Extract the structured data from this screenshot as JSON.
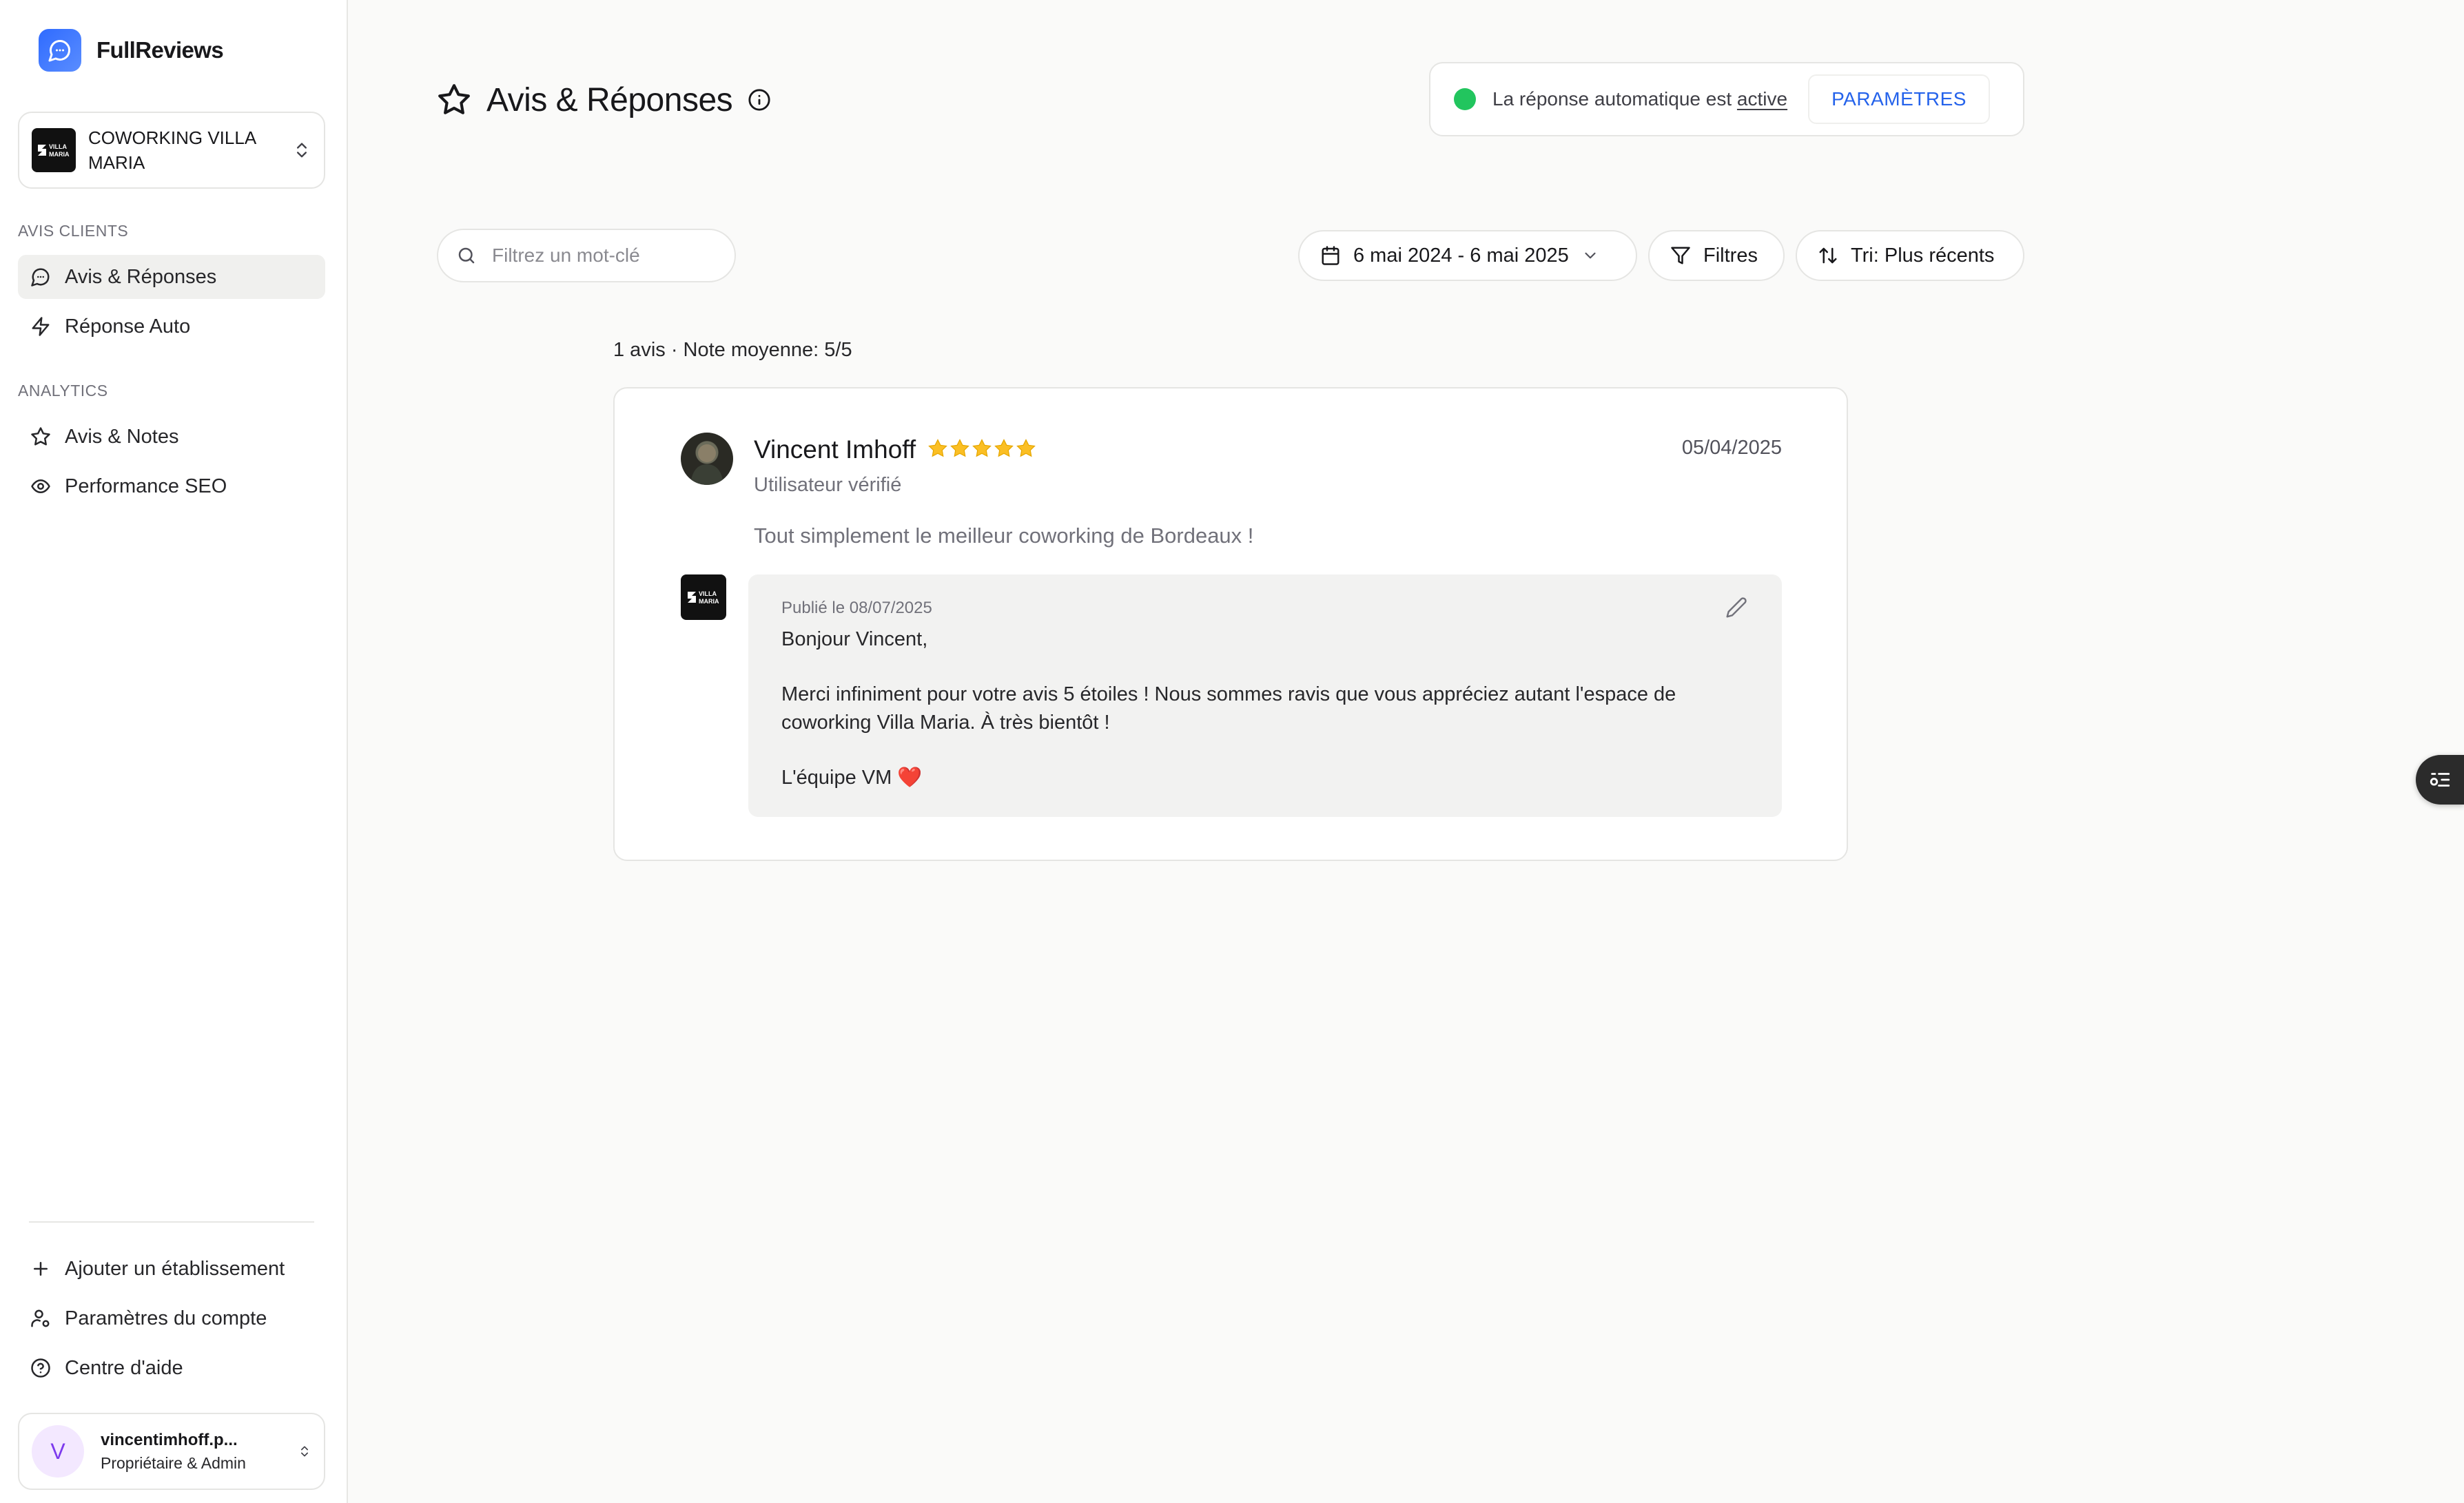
{
  "brand": {
    "name": "FullReviews",
    "accent": "#2f6bff"
  },
  "business": {
    "name": "COWORKING VILLA MARIA",
    "logo_text_1": "VILLA",
    "logo_text_2": "MARIA"
  },
  "sidebar": {
    "sections": [
      {
        "label": "AVIS CLIENTS",
        "items": [
          {
            "label": "Avis & Réponses",
            "icon": "chat-bubble-icon",
            "active": true
          },
          {
            "label": "Réponse Auto",
            "icon": "lightning-icon",
            "active": false
          }
        ]
      },
      {
        "label": "ANALYTICS",
        "items": [
          {
            "label": "Avis & Notes",
            "icon": "star-icon",
            "active": false
          },
          {
            "label": "Performance SEO",
            "icon": "eye-icon",
            "active": false
          }
        ]
      }
    ],
    "bottom_items": [
      {
        "label": "Ajouter un établissement",
        "icon": "plus-icon"
      },
      {
        "label": "Paramètres du compte",
        "icon": "user-settings-icon"
      },
      {
        "label": "Centre d'aide",
        "icon": "help-circle-icon"
      }
    ]
  },
  "user": {
    "initial": "V",
    "name": "vincentimhoff.p...",
    "role": "Propriétaire & Admin"
  },
  "header": {
    "title": "Avis & Réponses",
    "auto_reply_prefix": "La réponse automatique est",
    "auto_reply_status": "active",
    "settings_label": "PARAMÈTRES",
    "status_color": "#22c55e"
  },
  "filters": {
    "search_placeholder": "Filtrez un mot-clé",
    "date_range": "6 mai 2024 - 6 mai 2025",
    "filters_label": "Filtres",
    "sort_label": "Tri: Plus récents"
  },
  "summary": "1 avis · Note moyenne: 5/5",
  "review": {
    "author": "Vincent Imhoff",
    "rating": 5,
    "max_rating": 5,
    "verified_label": "Utilisateur vérifié",
    "date": "05/04/2025",
    "text": "Tout simplement le meilleur coworking de Bordeaux !",
    "star_color": "#fbbf24",
    "reply": {
      "published": "Publié le 08/07/2025",
      "greeting": "Bonjour Vincent,",
      "body": "Merci infiniment pour votre avis 5 étoiles ! Nous sommes ravis que vous appréciez autant l'espace de coworking Villa Maria. À très bientôt !",
      "signature": "L'équipe VM ❤️"
    }
  }
}
